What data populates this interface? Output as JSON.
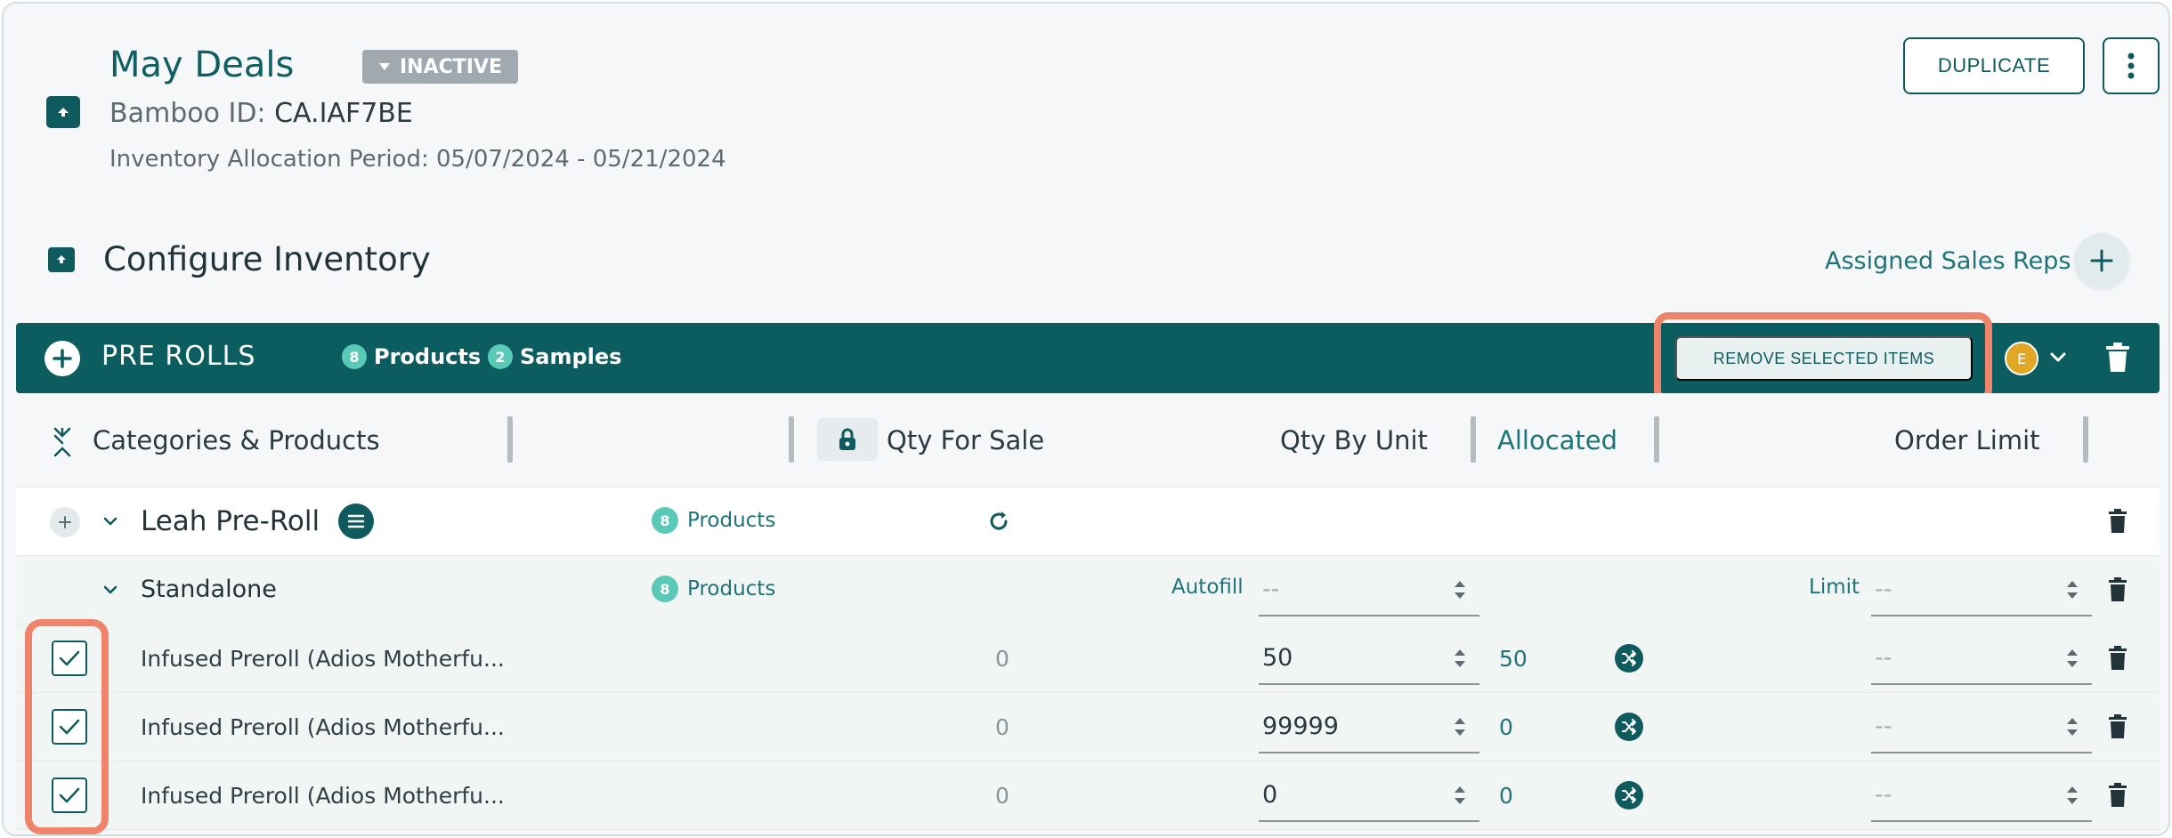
{
  "header": {
    "title": "May Deals",
    "status": "INACTIVE",
    "bamboo_label": "Bamboo ID:",
    "bamboo_id": "CA.IAF7BE",
    "period_label": "Inventory Allocation Period:",
    "period": "05/07/2024 - 05/21/2024",
    "duplicate_label": "DUPLICATE"
  },
  "configure": {
    "title": "Configure Inventory",
    "assigned_label": "Assigned Sales Reps"
  },
  "group": {
    "title": "PRE ROLLS",
    "products_count": "8",
    "products_label": "Products",
    "samples_count": "2",
    "samples_label": "Samples",
    "remove_label": "REMOVE SELECTED ITEMS",
    "avatar_initial": "E"
  },
  "columns": {
    "categories": "Categories & Products",
    "qty_for_sale": "Qty For Sale",
    "qty_by_unit": "Qty By Unit",
    "allocated": "Allocated",
    "order_limit": "Order Limit"
  },
  "category": {
    "name": "Leah Pre-Roll",
    "count": "8",
    "count_label": "Products"
  },
  "subgroup": {
    "name": "Standalone",
    "count": "8",
    "count_label": "Products",
    "autofill_label": "Autofill",
    "autofill_value": "--",
    "limit_label": "Limit",
    "limit_value": "--"
  },
  "products": [
    {
      "name": "Infused Preroll (Adios Motherfu...",
      "qty_for_sale": "0",
      "qty_by_unit": "50",
      "allocated": "50",
      "limit": "--"
    },
    {
      "name": "Infused Preroll (Adios Motherfu...",
      "qty_for_sale": "0",
      "qty_by_unit": "99999",
      "allocated": "0",
      "limit": "--"
    },
    {
      "name": "Infused Preroll (Adios Motherfu...",
      "qty_for_sale": "0",
      "qty_by_unit": "0",
      "allocated": "0",
      "limit": "--"
    }
  ],
  "colors": {
    "primary": "#0c5d60",
    "accent": "#5ac9b8",
    "highlight": "#f0846a"
  }
}
